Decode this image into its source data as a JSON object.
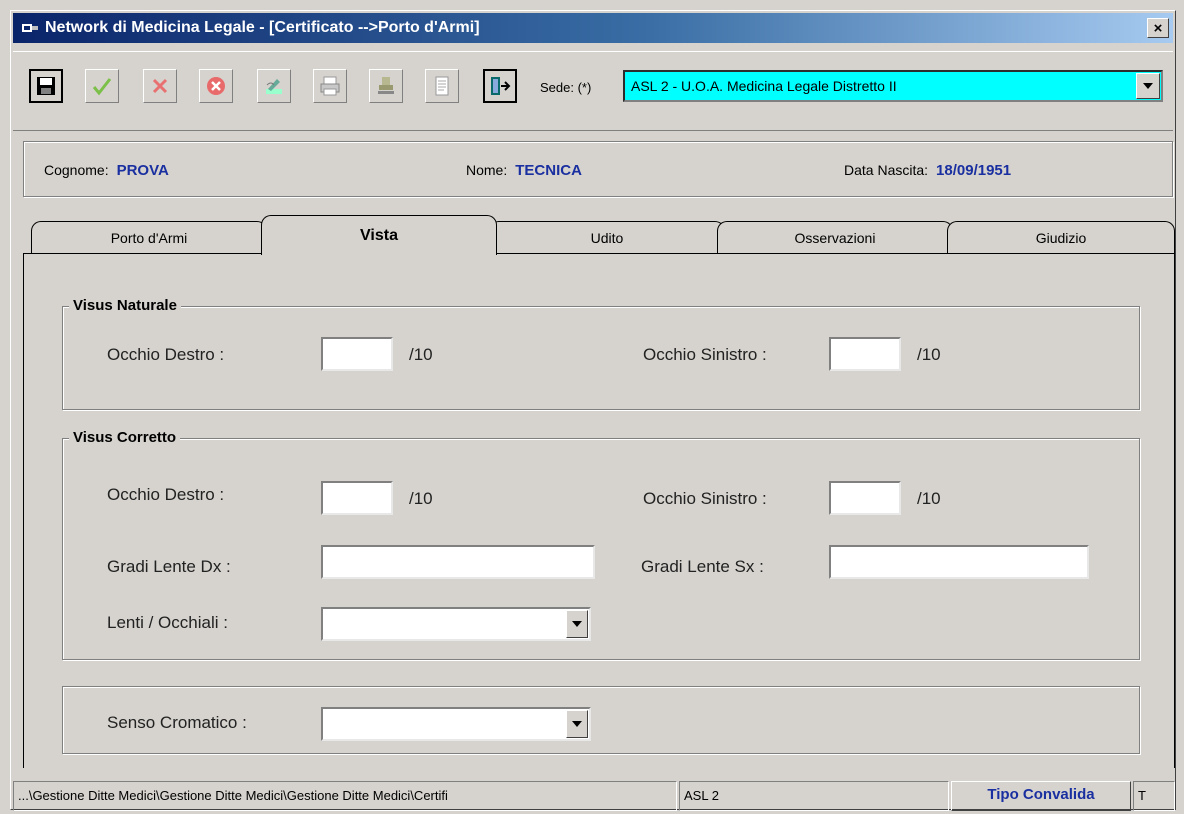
{
  "window": {
    "title": "Network di Medicina Legale - [Certificato -->Porto d'Armi]",
    "close": "×"
  },
  "toolbar": {
    "buttons": [
      "save-icon",
      "confirm-icon",
      "cancel-icon",
      "delete-icon",
      "edit-icon",
      "print-icon",
      "stamp-icon",
      "document-icon",
      "exit-icon"
    ],
    "sede_label": "Sede: (*)",
    "sede_value": "ASL 2 - U.O.A. Medicina Legale Distretto II",
    "sede_bg": "#00ffff"
  },
  "patient": {
    "cognome_label": "Cognome:",
    "cognome_value": "PROVA",
    "nome_label": "Nome:",
    "nome_value": "TECNICA",
    "nascita_label": "Data Nascita:",
    "nascita_value": "18/09/1951"
  },
  "tabs": [
    "Porto d'Armi",
    "Vista",
    "Udito",
    "Osservazioni",
    "Giudizio"
  ],
  "active_tab": "Vista",
  "vista": {
    "naturale": {
      "title": "Visus Naturale",
      "dx_label": "Occhio Destro :",
      "sx_label": "Occhio Sinistro :",
      "dx_value": "",
      "sx_value": "",
      "suffix": "/10"
    },
    "corretto": {
      "title": "Visus Corretto",
      "dx_label": "Occhio Destro :",
      "sx_label": "Occhio Sinistro :",
      "dx_value": "",
      "sx_value": "",
      "suffix": "/10",
      "gradi_dx_label": "Gradi Lente Dx :",
      "gradi_sx_label": "Gradi Lente Sx :",
      "gradi_dx_value": "",
      "gradi_sx_value": "",
      "lenti_label": "Lenti / Occhiali :",
      "lenti_value": ""
    },
    "senso": {
      "label": "Senso Cromatico :",
      "value": ""
    }
  },
  "status": {
    "path": "...\\Gestione Ditte Medici\\Gestione Ditte Medici\\Gestione Ditte Medici\\Certifi",
    "asl": "ASL 2",
    "tipo": "Tipo Convalida",
    "t": "T"
  },
  "colors": {
    "title_start": "#0a246a",
    "value_blue": "#1a2fa0",
    "face": "#d6d3ce"
  }
}
